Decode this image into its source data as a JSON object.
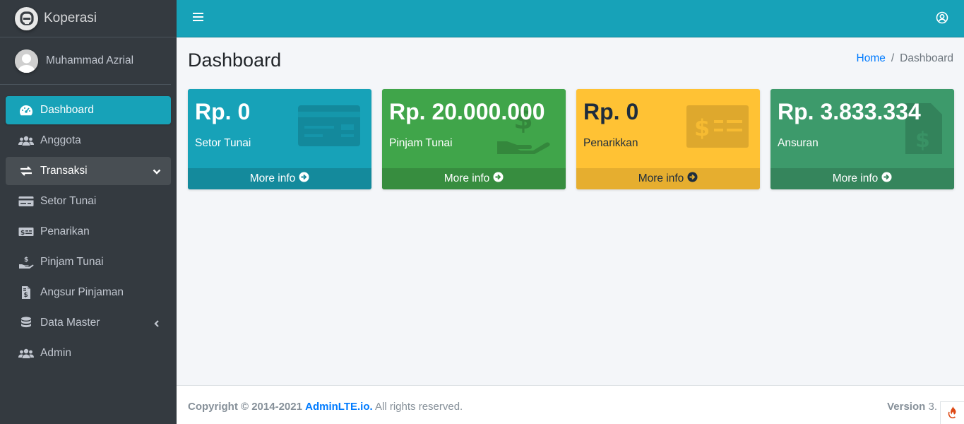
{
  "brand": {
    "name": "Koperasi"
  },
  "user": {
    "name": "Muhammad Azrial"
  },
  "sidebar": {
    "items": [
      {
        "label": "Dashboard",
        "icon": "tachometer-icon"
      },
      {
        "label": "Anggota",
        "icon": "users-icon"
      },
      {
        "label": "Transaksi",
        "icon": "exchange-icon"
      },
      {
        "label": "Setor Tunai",
        "icon": "credit-card-icon"
      },
      {
        "label": "Penarikan",
        "icon": "money-check-icon"
      },
      {
        "label": "Pinjam Tunai",
        "icon": "hand-holding-usd-icon"
      },
      {
        "label": "Angsur Pinjaman",
        "icon": "file-invoice-dollar-icon"
      },
      {
        "label": "Data Master",
        "icon": "database-icon"
      },
      {
        "label": "Admin",
        "icon": "users-icon"
      }
    ]
  },
  "header": {
    "page_title": "Dashboard"
  },
  "breadcrumb": {
    "home": "Home",
    "sep": "/",
    "current": "Dashboard"
  },
  "boxes": [
    {
      "amount": "Rp. 0",
      "label": "Setor Tunai",
      "more": "More info",
      "color": "#17a2b8"
    },
    {
      "amount": "Rp. 20.000.000",
      "label": "Pinjam Tunai",
      "more": "More info",
      "color": "#40a54a"
    },
    {
      "amount": "Rp. 0",
      "label": "Penarikkan",
      "more": "More info",
      "color": "#ffc234"
    },
    {
      "amount": "Rp. 3.833.334",
      "label": "Ansuran",
      "more": "More info",
      "color": "#3d9a6b"
    }
  ],
  "footer": {
    "copyright": "Copyright © 2014-2021",
    "brand_link": "AdminLTE.io.",
    "rights": "All rights reserved.",
    "version_label": "Version",
    "version_value": "3."
  },
  "colors": {
    "sidebar": "#343a40",
    "accent": "#17a2b8",
    "link": "#007bff"
  }
}
